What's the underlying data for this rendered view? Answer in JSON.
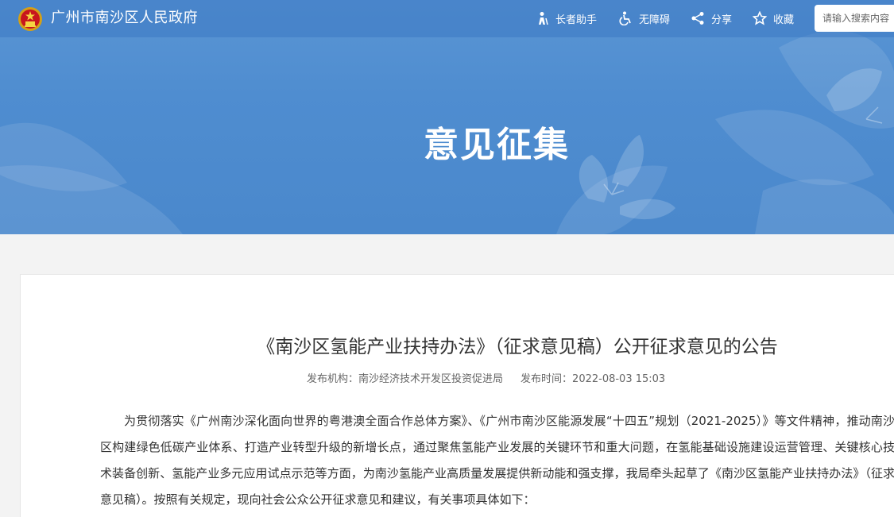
{
  "site": {
    "title": "广州市南沙区人民政府"
  },
  "toolbar": {
    "elder": "长者助手",
    "accessibility": "无障碍",
    "share": "分享",
    "favorite": "收藏"
  },
  "search": {
    "placeholder": "请输入搜索内容"
  },
  "banner": {
    "title": "意见征集"
  },
  "article": {
    "title": "《南沙区氢能产业扶持办法》（征求意见稿）公开征求意见的公告",
    "publisher_label": "发布机构：",
    "publisher": "南沙经济技术开发区投资促进局",
    "time_label": "发布时间：",
    "time": "2022-08-03 15:03",
    "paragraph": "为贯彻落实《广州南沙深化面向世界的粤港澳全面合作总体方案》、《广州市南沙区能源发展“十四五”规划（2021-2025）》等文件精神，推动南沙区构建绿色低碳产业体系、打造产业转型升级的新增长点，通过聚焦氢能产业发展的关键环节和重大问题，在氢能基础设施建设运营管理、关键核心技术装备创新、氢能产业多元应用试点示范等方面，为南沙氢能产业高质量发展提供新动能和强支撑，我局牵头起草了《南沙区氢能产业扶持办法》（征求意见稿）。按照有关规定，现向社会公众公开征求意见和建议，有关事项具体如下："
  }
}
